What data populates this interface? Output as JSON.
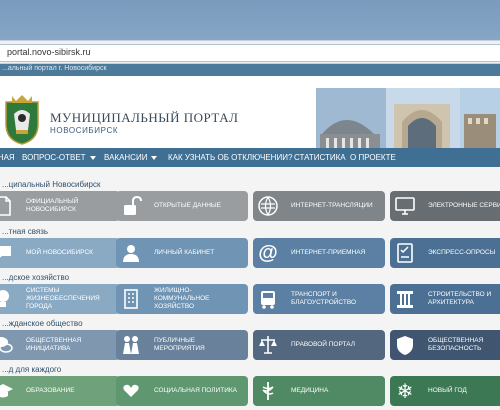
{
  "browser": {
    "url": "portal.novo-sibirsk.ru"
  },
  "topstrip": {
    "text": "...альный портал г. Новосибирск"
  },
  "header": {
    "title": "МУНИЦИПАЛЬНЫЙ ПОРТАЛ",
    "subtitle": "НОВОСИБИРСК"
  },
  "nav": {
    "items": [
      {
        "label": "ГЛАВНАЯ",
        "caret": false
      },
      {
        "label": "ВОПРОС-ОТВЕТ",
        "caret": true
      },
      {
        "label": "ВАКАНСИИ",
        "caret": true
      },
      {
        "label": "КАК УЗНАТЬ ОБ ОТКЛЮЧЕНИИ?",
        "caret": false
      },
      {
        "label": "СТАТИСТИКА",
        "caret": false
      },
      {
        "label": "О ПРОЕКТЕ",
        "caret": false
      }
    ]
  },
  "sections": [
    {
      "title": "...ципальный Новосибирск",
      "tiles": [
        {
          "label": "ОФИЦИАЛЬНЫЙ НОВОСИБИРСК",
          "icon": "document-icon"
        },
        {
          "label": "ОТКРЫТЫЕ ДАННЫЕ",
          "icon": "open-lock-icon"
        },
        {
          "label": "ИНТЕРНЕТ-ТРАНСЛЯЦИИ",
          "icon": "broadcast-icon"
        },
        {
          "label": "ЭЛЕКТРОННЫЕ СЕРВИСЫ",
          "icon": "monitor-icon"
        }
      ]
    },
    {
      "title": "...тная связь",
      "tiles": [
        {
          "label": "МОЙ НОВОСИБИРСК",
          "icon": "chat-icon"
        },
        {
          "label": "ЛИЧНЫЙ КАБИНЕТ",
          "icon": "user-icon"
        },
        {
          "label": "ИНТЕРНЕТ-ПРИЕМНАЯ",
          "icon": "at-sign-icon"
        },
        {
          "label": "ЭКСПРЕСС-ОПРОСЫ",
          "icon": "checklist-icon"
        }
      ]
    },
    {
      "title": "...дское хозяйство",
      "tiles": [
        {
          "label": "СИСТЕМЫ ЖИЗНЕОБЕСПЕЧЕНИЯ ГОРОДА",
          "icon": "lightbulb-icon"
        },
        {
          "label": "ЖИЛИЩНО-КОММУНАЛЬНОЕ ХОЗЯЙСТВО",
          "icon": "building-icon"
        },
        {
          "label": "ТРАНСПОРТ И БЛАГОУСТРОЙСТВО",
          "icon": "bus-icon"
        },
        {
          "label": "СТРОИТЕЛЬСТВО И АРХИТЕКТУРА",
          "icon": "column-icon"
        }
      ]
    },
    {
      "title": "...жданское общество",
      "tiles": [
        {
          "label": "ОБЩЕСТВЕННАЯ ИНИЦИАТИВА",
          "icon": "speech-bubbles-icon"
        },
        {
          "label": "ПУБЛИЧНЫЕ МЕРОПРИЯТИЯ",
          "icon": "people-icon"
        },
        {
          "label": "ПРАВОВОЙ ПОРТАЛ",
          "icon": "scales-icon"
        },
        {
          "label": "ОБЩЕСТВЕННАЯ БЕЗОПАСНОСТЬ",
          "icon": "shield-icon"
        }
      ]
    },
    {
      "title": "...д для каждого",
      "tiles": [
        {
          "label": "ОБРАЗОВАНИЕ",
          "icon": "graduation-cap-icon"
        },
        {
          "label": "СОЦИАЛЬНАЯ ПОЛИТИКА",
          "icon": "heart-hands-icon"
        },
        {
          "label": "МЕДИЦИНА",
          "icon": "caduceus-icon"
        },
        {
          "label": "НОВЫЙ ГОД",
          "icon": "snowflake-icon"
        }
      ]
    }
  ]
}
